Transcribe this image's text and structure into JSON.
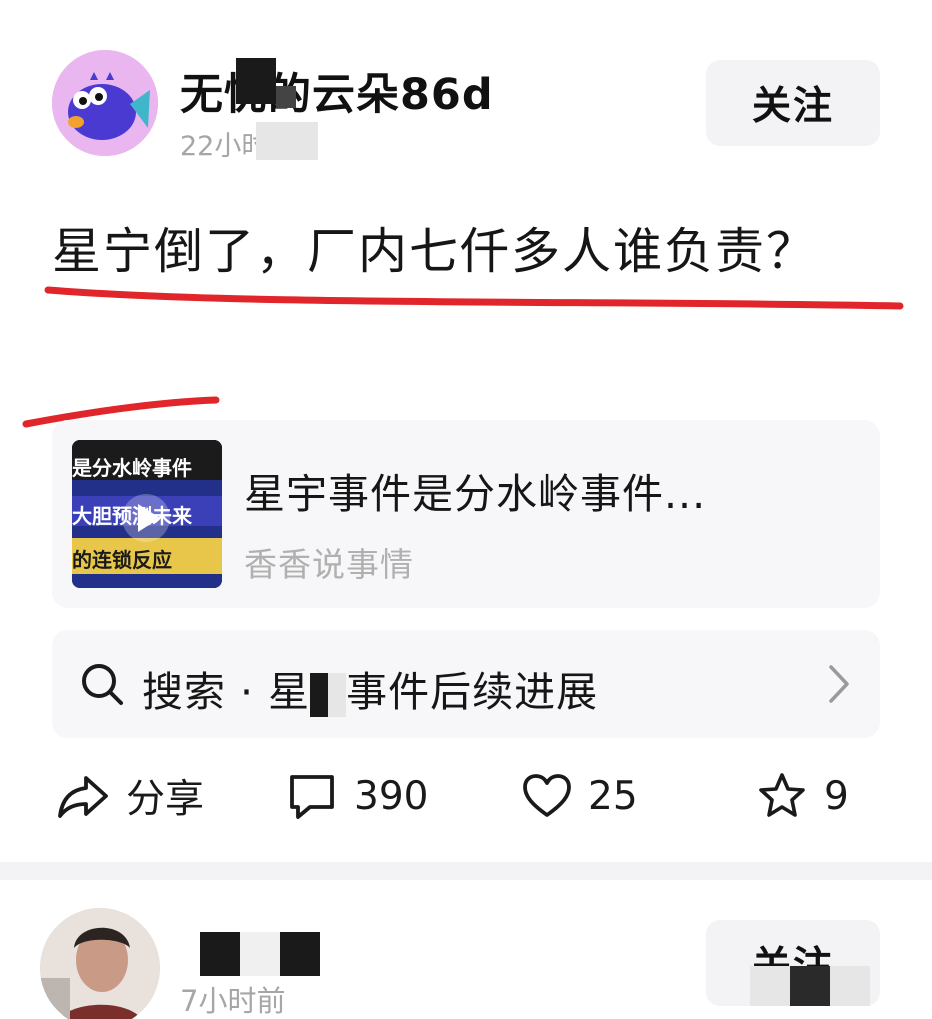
{
  "post": {
    "username": "无忧的云朵86d",
    "timestamp": "22小时前",
    "follow_label": "关注",
    "text": "星宁倒了，厂内七仟多人谁负责？"
  },
  "link_card": {
    "title": "星宇事件是分水岭事件...",
    "source": "香香说事情",
    "thumbnail_captions": [
      "是分水岭事件",
      "大胆预测未来",
      "的连锁反应"
    ]
  },
  "search": {
    "prefix": "搜索 · 星",
    "suffix": "事件后续进展",
    "icon": "search-icon"
  },
  "actions": {
    "share": "分享",
    "comments": "390",
    "likes": "25",
    "favorites": "9"
  },
  "next_post": {
    "timestamp": "7小时前",
    "follow_label": "关注"
  },
  "colors": {
    "accent_red": "#e0262a",
    "button_bg": "#f3f3f5",
    "card_bg": "#f7f7f9",
    "muted_text": "#a6a6a6"
  }
}
